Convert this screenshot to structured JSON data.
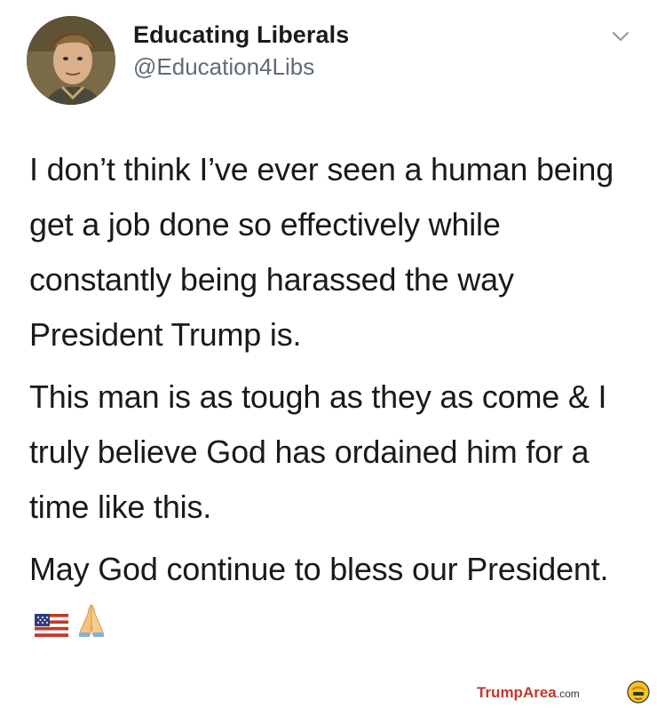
{
  "tweet": {
    "display_name": "Educating Liberals",
    "handle": "@Education4Libs",
    "menu_icon": "chevron-down-icon",
    "paragraphs": [
      "I don’t think I’ve ever seen a human being get a job done so effectively while constantly being harassed the way President Trump is.",
      "This man is as tough as they as come & I truly believe God has ordained him for a time like this.",
      "May God continue to bless our President."
    ],
    "emojis": [
      "us-flag-icon",
      "folded-hands-icon"
    ]
  },
  "watermark": {
    "site": "TrumpArea",
    "domain": ".com"
  }
}
